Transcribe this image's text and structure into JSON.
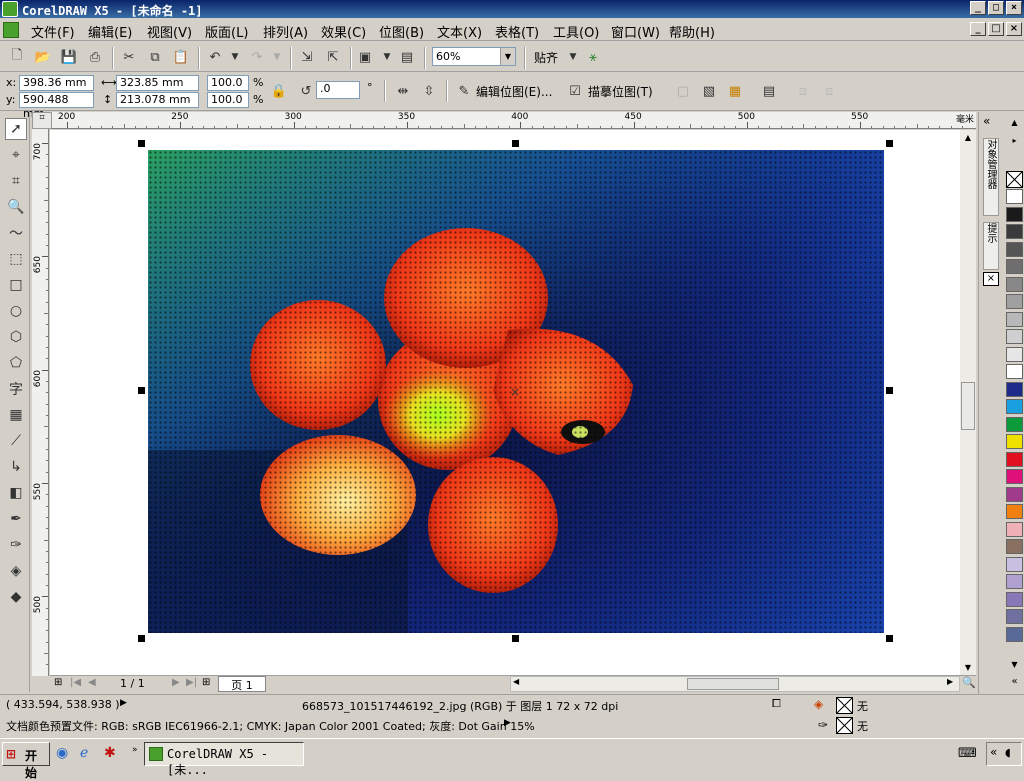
{
  "window": {
    "title": "CorelDRAW X5 - [未命名 -1]"
  },
  "menu": [
    "文件(F)",
    "编辑(E)",
    "视图(V)",
    "版面(L)",
    "排列(A)",
    "效果(C)",
    "位图(B)",
    "文本(X)",
    "表格(T)",
    "工具(O)",
    "窗口(W)",
    "帮助(H)"
  ],
  "toolbar": {
    "zoom": "60%",
    "snap": "贴齐"
  },
  "props": {
    "x_label": "x:",
    "x": "398.36 mm",
    "y_label": "y:",
    "y": "590.488 mm",
    "w": "323.85 mm",
    "h": "213.078 mm",
    "scale_w": "100.0",
    "scale_h": "100.0",
    "pct": "%",
    "rotate": ".0",
    "deg": "°",
    "edit_bitmap": "编辑位图(E)...",
    "trace_bitmap": "描摹位图(T)"
  },
  "ruler": {
    "h_ticks": [
      "200",
      "250",
      "300",
      "350",
      "400",
      "450",
      "500",
      "550"
    ],
    "v_ticks": [
      "700",
      "650",
      "600",
      "550",
      "500"
    ],
    "unit": "毫米"
  },
  "pagebar": {
    "page_count": "1 / 1",
    "page_tab": "页 1"
  },
  "dock": {
    "tab1": "对象管理器",
    "tab2": "提示"
  },
  "palette": [
    "#ffffff",
    "#1a1a1a",
    "#3a3a3a",
    "#555555",
    "#6e6e6e",
    "#888888",
    "#a0a0a0",
    "#b8b8b8",
    "#cfcfcf",
    "#e6e6e6",
    "#ffffff",
    "#1e2a8a",
    "#1aa0e0",
    "#0a9a3a",
    "#f0e000",
    "#e01020",
    "#e0107a",
    "#a03a8a",
    "#f08010",
    "#f0b0b8",
    "#8a7060",
    "#c8c0e0",
    "#b0a0d0",
    "#8878b8",
    "#7070a0",
    "#5a6a98"
  ],
  "status": {
    "coords": "( 433.594, 538.938 )",
    "object": "668573_101517446192_2.jpg (RGB) 于 图层 1 72 x 72 dpi",
    "profile": "文档颜色预置文件: RGB: sRGB IEC61966-2.1; CMYK: Japan Color 2001 Coated; 灰度: Dot Gain 15%",
    "fill": "无",
    "outline": "无"
  },
  "taskbar": {
    "start": "开始",
    "task": "CorelDRAW X5 - [未..."
  }
}
